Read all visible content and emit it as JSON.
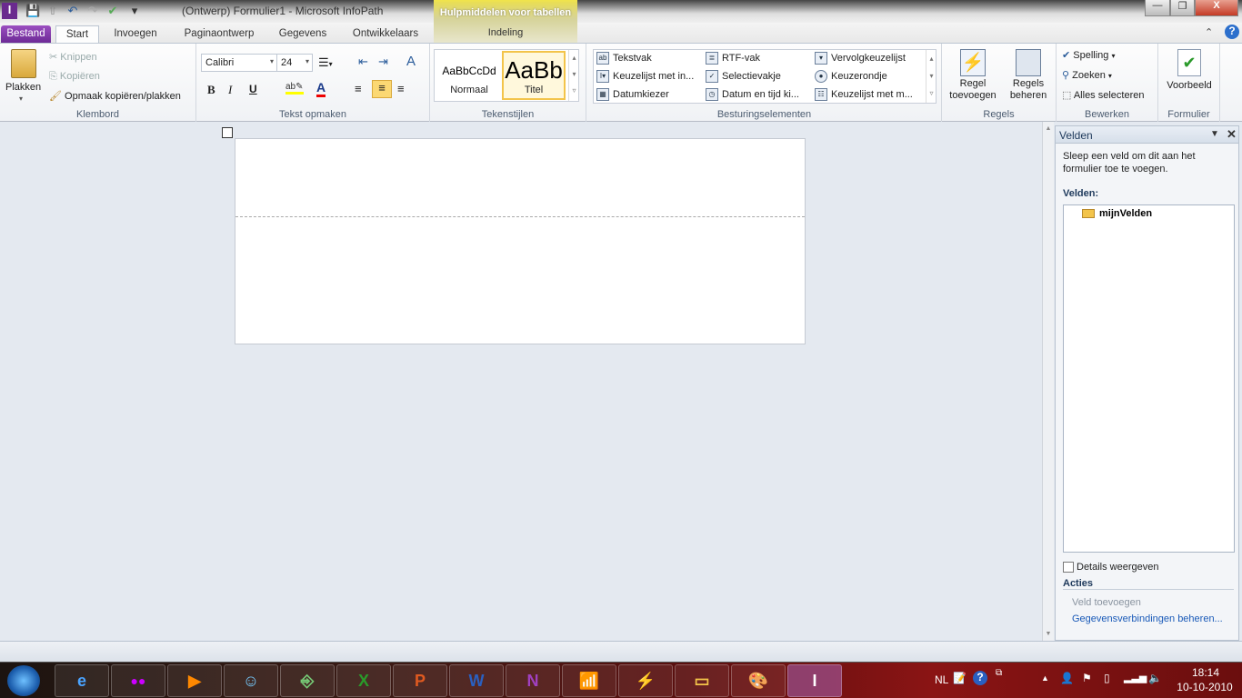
{
  "window": {
    "title": "(Ontwerp) Formulier1  -  Microsoft InfoPath",
    "contextual_group": "Hulpmiddelen voor tabellen",
    "contextual_tab": "Indeling"
  },
  "tabs": [
    "Bestand",
    "Start",
    "Invoegen",
    "Paginaontwerp",
    "Gegevens",
    "Ontwikkelaars"
  ],
  "ribbon": {
    "clipboard": {
      "label": "Klembord",
      "paste": "Plakken",
      "cut": "Knippen",
      "copy": "Kopiëren",
      "format_painter": "Opmaak kopiëren/plakken"
    },
    "font": {
      "label": "Tekst opmaken",
      "font_name": "Calibri",
      "font_size": "24",
      "bold": "B",
      "italic": "I",
      "underline": "U"
    },
    "styles": {
      "label": "Tekenstijlen",
      "items": [
        {
          "sample": "AaBbCcDd",
          "name": "Normaal"
        },
        {
          "sample": "AaBb",
          "name": "Titel"
        }
      ]
    },
    "controls": {
      "label": "Besturingselementen",
      "items": [
        "Tekstvak",
        "RTF-vak",
        "Vervolgkeuzelijst",
        "Keuzelijst met in...",
        "Selectievakje",
        "Keuzerondje",
        "Datumkiezer",
        "Datum en tijd ki...",
        "Keuzelijst met m..."
      ]
    },
    "rules": {
      "label": "Regels",
      "add_rule": "Regel toevoegen",
      "manage_rules": "Regels beheren"
    },
    "editing": {
      "label": "Bewerken",
      "spelling": "Spelling",
      "find": "Zoeken",
      "select_all": "Alles selecteren"
    },
    "form": {
      "label": "Formulier",
      "preview": "Voorbeeld"
    }
  },
  "panel": {
    "title": "Velden",
    "description": "Sleep een veld om dit aan het formulier toe te voegen.",
    "fields_label": "Velden:",
    "root_group": "mijnVelden",
    "show_details": "Details weergeven",
    "actions_label": "Acties",
    "add_field": "Veld toevoegen",
    "manage_connections": "Gegevensverbindingen beheren..."
  },
  "taskbar": {
    "language": "NL",
    "time": "18:14",
    "date": "10-10-2010"
  }
}
